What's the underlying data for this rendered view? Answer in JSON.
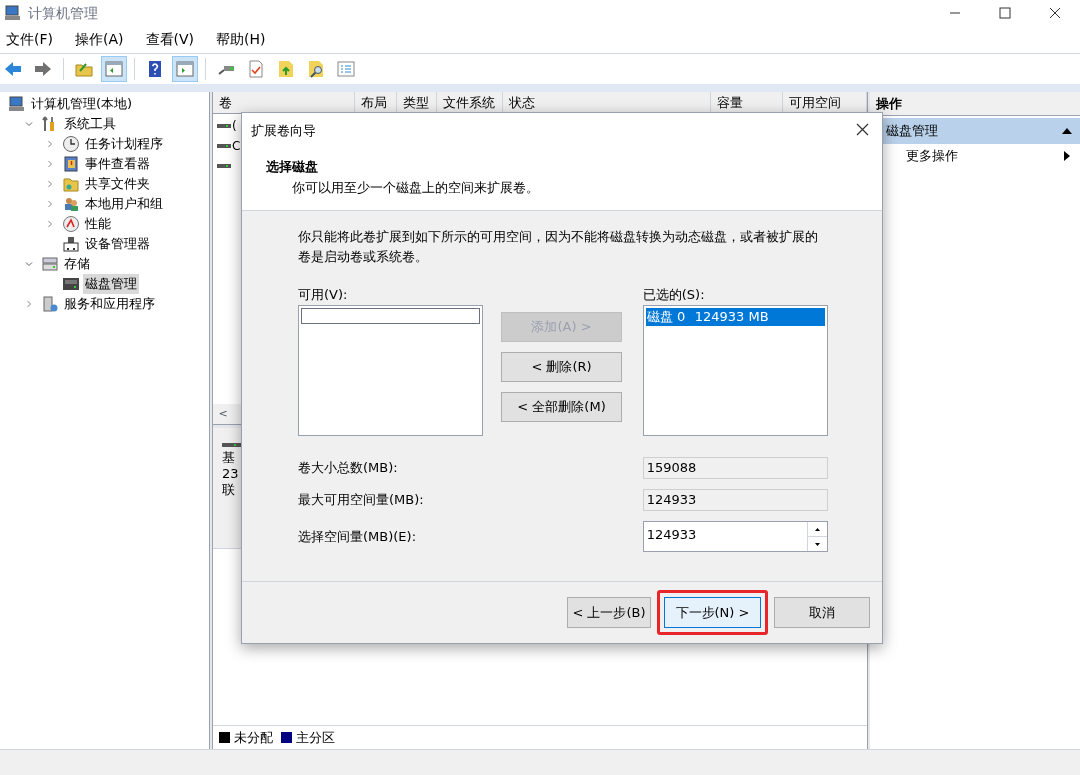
{
  "window": {
    "title": "计算机管理"
  },
  "menu": [
    "文件(F)",
    "操作(A)",
    "查看(V)",
    "帮助(H)"
  ],
  "toolbar": [
    {
      "pressed": false
    },
    {
      "pressed": false
    },
    {
      "pressed": false
    },
    {
      "pressed": true
    },
    {
      "pressed": false
    },
    {
      "pressed": true
    },
    {
      "pressed": false
    },
    {
      "pressed": false
    },
    {
      "pressed": false
    },
    {
      "pressed": false
    },
    {
      "pressed": false
    }
  ],
  "tree": [
    {
      "label": "计算机管理(本地)",
      "kind": "root",
      "selected": false,
      "children": [
        {
          "label": "系统工具",
          "kind": "open",
          "selected": false,
          "children": [
            {
              "label": "任务计划程序",
              "kind": "closed",
              "selected": false
            },
            {
              "label": "事件查看器",
              "kind": "closed",
              "selected": false
            },
            {
              "label": "共享文件夹",
              "kind": "closed",
              "selected": false
            },
            {
              "label": "本地用户和组",
              "kind": "closed",
              "selected": false
            },
            {
              "label": "性能",
              "kind": "closed",
              "selected": false
            },
            {
              "label": "设备管理器",
              "kind": "leaf",
              "selected": false
            }
          ]
        },
        {
          "label": "存储",
          "kind": "open",
          "selected": false,
          "children": [
            {
              "label": "磁盘管理",
              "kind": "leaf",
              "selected": true
            }
          ]
        },
        {
          "label": "服务和应用程序",
          "kind": "closed",
          "selected": false
        }
      ]
    }
  ],
  "volume_table": {
    "columns": [
      "卷",
      "布局",
      "类型",
      "文件系统",
      "状态",
      "容量",
      "可用空间"
    ],
    "scroll_left": "<",
    "rows": [
      {
        "label": "("
      },
      {
        "label": "C"
      },
      {}
    ]
  },
  "disk_panel": {
    "lines": [
      "基",
      "23",
      "联"
    ]
  },
  "legend": [
    {
      "label": "未分配",
      "color": "#000000"
    },
    {
      "label": "主分区",
      "color": "#000080"
    }
  ],
  "actions": {
    "title": "操作",
    "section": "磁盘管理",
    "items": [
      "更多操作"
    ]
  },
  "dialog": {
    "title": "扩展卷向导",
    "heading": "选择磁盘",
    "subtitle": "你可以用至少一个磁盘上的空间来扩展卷。",
    "description": "你只能将此卷扩展到如下所示的可用空间，因为不能将磁盘转换为动态磁盘，或者被扩展的卷是启动卷或系统卷。",
    "available_label": "可用(V):",
    "selected_label": "已选的(S):",
    "selected_disks": [
      {
        "disk": "磁盘 0",
        "size": "124933 MB",
        "selected": true
      }
    ],
    "move_buttons": [
      {
        "label": "添加(A) >",
        "disabled": true
      },
      {
        "label": "< 删除(R)",
        "disabled": false
      },
      {
        "label": "< 全部删除(M)",
        "disabled": false
      }
    ],
    "fields": [
      {
        "label": "卷大小总数(MB):",
        "value": "159088",
        "kind": "readonly"
      },
      {
        "label": "最大可用空间量(MB):",
        "value": "124933",
        "kind": "readonly"
      },
      {
        "label": "选择空间量(MB)(E):",
        "value": "124933",
        "kind": "spinner"
      }
    ],
    "buttons": [
      {
        "label": "< 上一步(B)",
        "default": false,
        "highlighted": false
      },
      {
        "label": "下一步(N) >",
        "default": true,
        "highlighted": true
      },
      {
        "label": "取消",
        "default": false,
        "highlighted": false
      }
    ]
  }
}
